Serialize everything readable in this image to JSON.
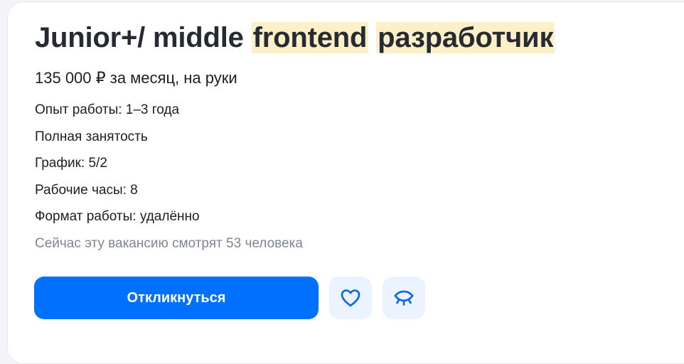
{
  "vacancy": {
    "title_prefix": "Junior+/ middle",
    "title_highlight_1": "frontend",
    "title_highlight_2": "разработчик",
    "salary": "135 000 ₽ за месяц, на руки",
    "details": [
      "Опыт работы: 1–3 года",
      "Полная занятость",
      "График: 5/2",
      "Рабочие часы: 8",
      "Формат работы: удалённо"
    ],
    "viewers": "Сейчас эту вакансию смотрят 53 человека"
  },
  "actions": {
    "apply_label": "Откликнуться",
    "favorite_icon": "heart-icon",
    "hide_icon": "eye-closed-icon"
  },
  "colors": {
    "accent": "#0070ff",
    "highlight": "#fdefc8",
    "icon_button_bg": "#eaf3ff",
    "muted_text": "#7d8794"
  }
}
